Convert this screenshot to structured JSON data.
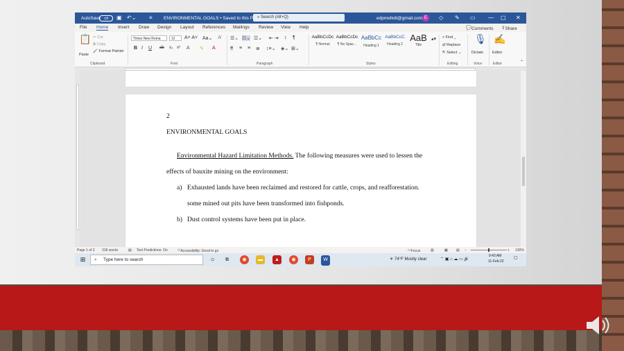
{
  "titlebar": {
    "autosave_label": "AutoSave",
    "autosave_state": "Off",
    "doc_title": "ENVIRONMENTAL GOALS • Saved to this PC ⌄",
    "search_placeholder": "Search (Alt+Q)",
    "account_email": "edpmellott@gmail.com",
    "avatar_letter": "E"
  },
  "menu": {
    "tabs": [
      "File",
      "Home",
      "Insert",
      "Draw",
      "Design",
      "Layout",
      "References",
      "Mailings",
      "Review",
      "View",
      "Help"
    ],
    "comments": "Comments",
    "share": "Share"
  },
  "ribbon": {
    "clipboard": {
      "paste": "Paste",
      "cut": "Cut",
      "copy": "Copy",
      "format_painter": "Format Painter",
      "label": "Clipboard"
    },
    "font": {
      "name": "Times New Roma",
      "size": "12",
      "label": "Font"
    },
    "paragraph": {
      "label": "Paragraph"
    },
    "styles": {
      "items": [
        {
          "preview": "AaBbCcDc",
          "name": "¶ Normal"
        },
        {
          "preview": "AaBbCcDc",
          "name": "¶ No Spac..."
        },
        {
          "preview": "AaBbCc",
          "name": "Heading 1"
        },
        {
          "preview": "AaBbCcC",
          "name": "Heading 2"
        },
        {
          "preview": "AaB",
          "name": "Title"
        }
      ],
      "label": "Styles"
    },
    "editing": {
      "find": "Find",
      "replace": "Replace",
      "select": "Select",
      "label": "Editing"
    },
    "voice": {
      "dictate": "Dictate",
      "label": "Voice"
    },
    "editor": {
      "editor": "Editor",
      "label": "Editor"
    }
  },
  "document": {
    "page_number": "2",
    "heading": "ENVIRONMENTAL GOALS",
    "para_underlined": "Environmental Hazard Limitation Methods.",
    "para_rest": " The following measures were used to lessen the",
    "para_line2": "effects of bauxite mining on the environment:",
    "list": [
      {
        "marker": "a)",
        "text": "Exhausted lands have been reclaimed and restored for cattle, crops, and reafforestation."
      },
      {
        "marker": "",
        "text": "some mined out pits have been transformed into fishponds."
      },
      {
        "marker": "b)",
        "text": "Dust control systems have been put in place."
      }
    ]
  },
  "status": {
    "page": "Page 1 of 3",
    "words": "318 words",
    "text_predictions": "Text Predictions: On",
    "accessibility": "Accessibility: Good to go",
    "focus": "Focus",
    "zoom": "130%"
  },
  "taskbar": {
    "search_placeholder": "Type here to search",
    "weather": "74°F  Mostly clear",
    "time": "9:43 AM",
    "date": "11-Feb-22"
  }
}
